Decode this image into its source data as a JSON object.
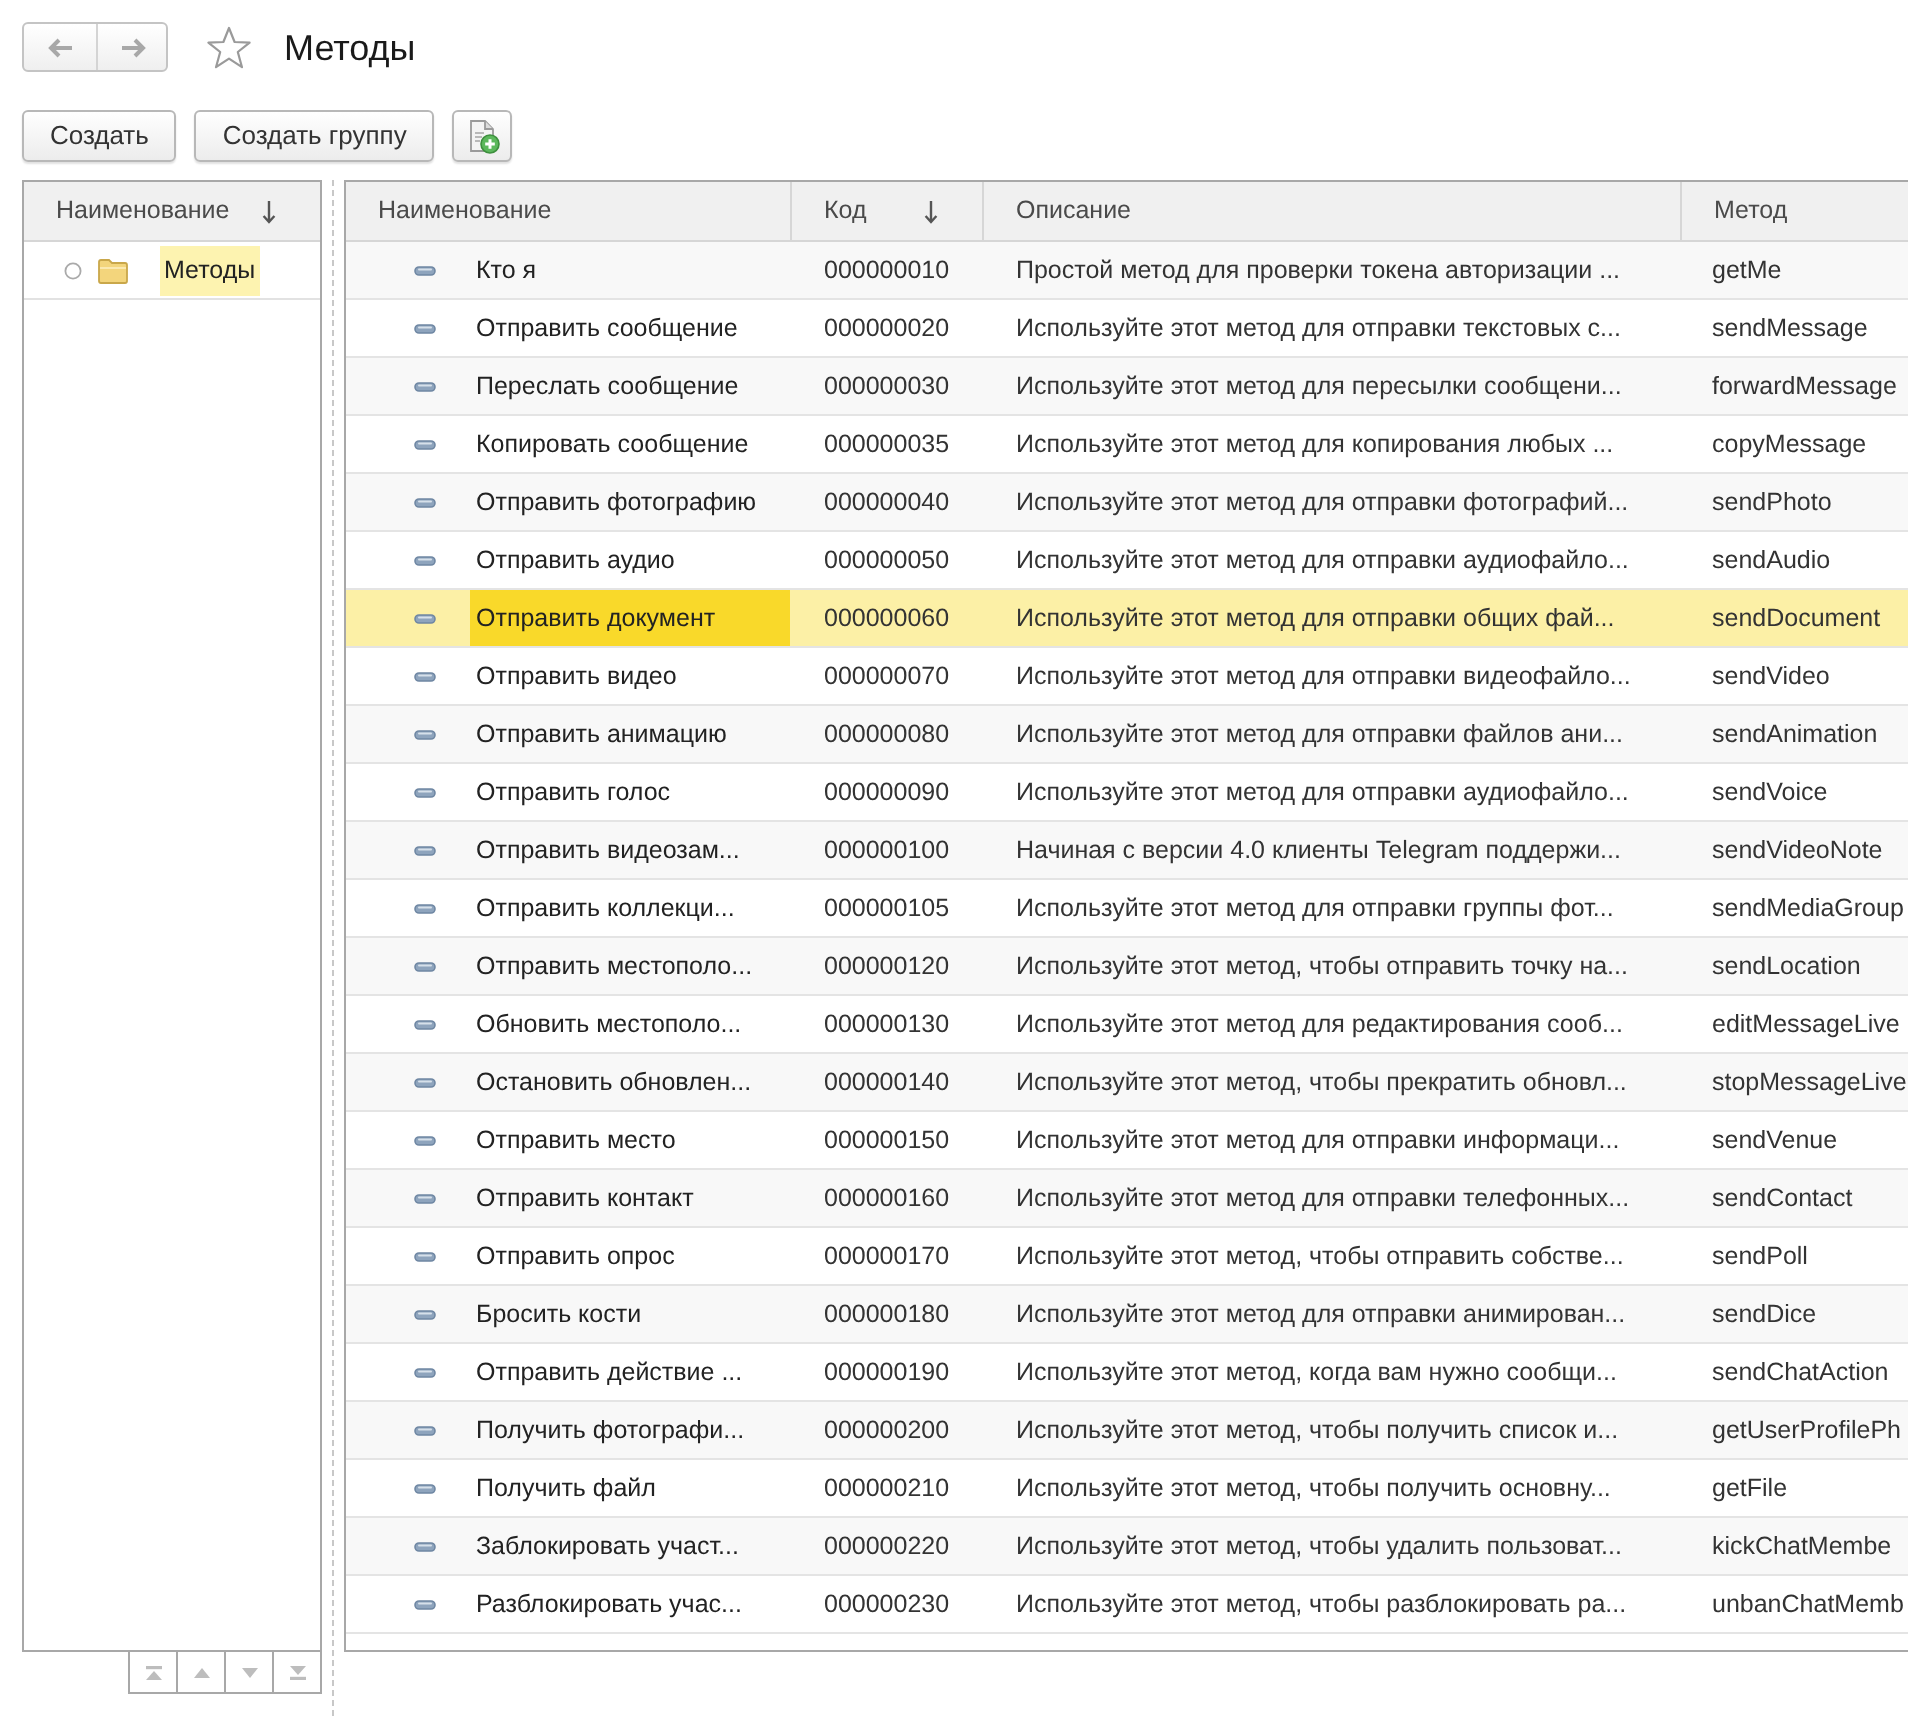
{
  "title": "Методы",
  "favorite": false,
  "toolbar": {
    "buttons": [
      {
        "kind": "text",
        "label": "Создать"
      },
      {
        "kind": "text",
        "label": "Создать группу"
      },
      {
        "kind": "icon"
      }
    ]
  },
  "tree": {
    "columns": [
      {
        "label": "Наименование",
        "sorted": true
      }
    ],
    "items": [
      {
        "label": "Методы",
        "selected": true
      }
    ]
  },
  "table": {
    "columns": [
      {
        "label": "Наименование",
        "sorted": false
      },
      {
        "label": "Код",
        "sorted": true
      },
      {
        "label": "Описание",
        "sorted": false
      },
      {
        "label": "Метод",
        "sorted": false
      }
    ],
    "rows": [
      {
        "name": "Кто я",
        "code": "000000010",
        "description": "Простой метод для проверки токена авторизации ...",
        "method": "getMe",
        "selected": false
      },
      {
        "name": "Отправить сообщение",
        "code": "000000020",
        "description": "Используйте этот метод для отправки текстовых с...",
        "method": "sendMessage",
        "selected": false
      },
      {
        "name": "Переслать сообщение",
        "code": "000000030",
        "description": "Используйте этот метод для пересылки сообщени...",
        "method": "forwardMessage",
        "selected": false
      },
      {
        "name": "Копировать сообщение",
        "code": "000000035",
        "description": "Используйте этот метод для копирования любых ...",
        "method": "copyMessage",
        "selected": false
      },
      {
        "name": "Отправить фотографию",
        "code": "000000040",
        "description": "Используйте этот метод для отправки фотографий...",
        "method": "sendPhoto",
        "selected": false
      },
      {
        "name": "Отправить аудио",
        "code": "000000050",
        "description": "Используйте этот метод для отправки аудиофайло...",
        "method": "sendAudio",
        "selected": false
      },
      {
        "name": "Отправить документ",
        "code": "000000060",
        "description": "Используйте этот метод для отправки общих фай...",
        "method": "sendDocument",
        "selected": true
      },
      {
        "name": "Отправить видео",
        "code": "000000070",
        "description": "Используйте этот метод для отправки видеофайло...",
        "method": "sendVideo",
        "selected": false
      },
      {
        "name": "Отправить анимацию",
        "code": "000000080",
        "description": "Используйте этот метод для отправки файлов ани...",
        "method": "sendAnimation",
        "selected": false
      },
      {
        "name": "Отправить голос",
        "code": "000000090",
        "description": "Используйте этот метод для отправки аудиофайло...",
        "method": "sendVoice",
        "selected": false
      },
      {
        "name": "Отправить видеозам...",
        "code": "000000100",
        "description": "Начиная с версии 4.0 клиенты Telegram поддержи...",
        "method": "sendVideoNote",
        "selected": false
      },
      {
        "name": "Отправить коллекци...",
        "code": "000000105",
        "description": "Используйте этот метод для отправки группы фот...",
        "method": "sendMediaGroup",
        "selected": false
      },
      {
        "name": "Отправить местополо...",
        "code": "000000120",
        "description": "Используйте этот метод, чтобы отправить точку на...",
        "method": "sendLocation",
        "selected": false
      },
      {
        "name": "Обновить местополо...",
        "code": "000000130",
        "description": "Используйте этот метод для редактирования сооб...",
        "method": "editMessageLive",
        "selected": false
      },
      {
        "name": "Остановить обновлен...",
        "code": "000000140",
        "description": "Используйте этот метод, чтобы прекратить обновл...",
        "method": "stopMessageLive",
        "selected": false
      },
      {
        "name": "Отправить место",
        "code": "000000150",
        "description": "Используйте этот метод для отправки информаци...",
        "method": "sendVenue",
        "selected": false
      },
      {
        "name": "Отправить контакт",
        "code": "000000160",
        "description": "Используйте этот метод для отправки телефонных...",
        "method": "sendContact",
        "selected": false
      },
      {
        "name": "Отправить опрос",
        "code": "000000170",
        "description": "Используйте этот метод, чтобы отправить собстве...",
        "method": "sendPoll",
        "selected": false
      },
      {
        "name": "Бросить кости",
        "code": "000000180",
        "description": "Используйте этот метод для отправки анимирован...",
        "method": "sendDice",
        "selected": false
      },
      {
        "name": "Отправить действие ...",
        "code": "000000190",
        "description": "Используйте этот метод, когда вам нужно сообщи...",
        "method": "sendChatAction",
        "selected": false
      },
      {
        "name": "Получить фотографи...",
        "code": "000000200",
        "description": "Используйте этот метод, чтобы получить список и...",
        "method": "getUserProfilePh",
        "selected": false
      },
      {
        "name": "Получить файл",
        "code": "000000210",
        "description": "Используйте этот метод, чтобы получить основну...",
        "method": "getFile",
        "selected": false
      },
      {
        "name": "Заблокировать участ...",
        "code": "000000220",
        "description": "Используйте этот метод, чтобы удалить пользоват...",
        "method": "kickChatMembe",
        "selected": false
      },
      {
        "name": "Разблокировать учас...",
        "code": "000000230",
        "description": "Используйте этот метод, чтобы разблокировать ра...",
        "method": "unbanChatMemb",
        "selected": false
      }
    ]
  }
}
